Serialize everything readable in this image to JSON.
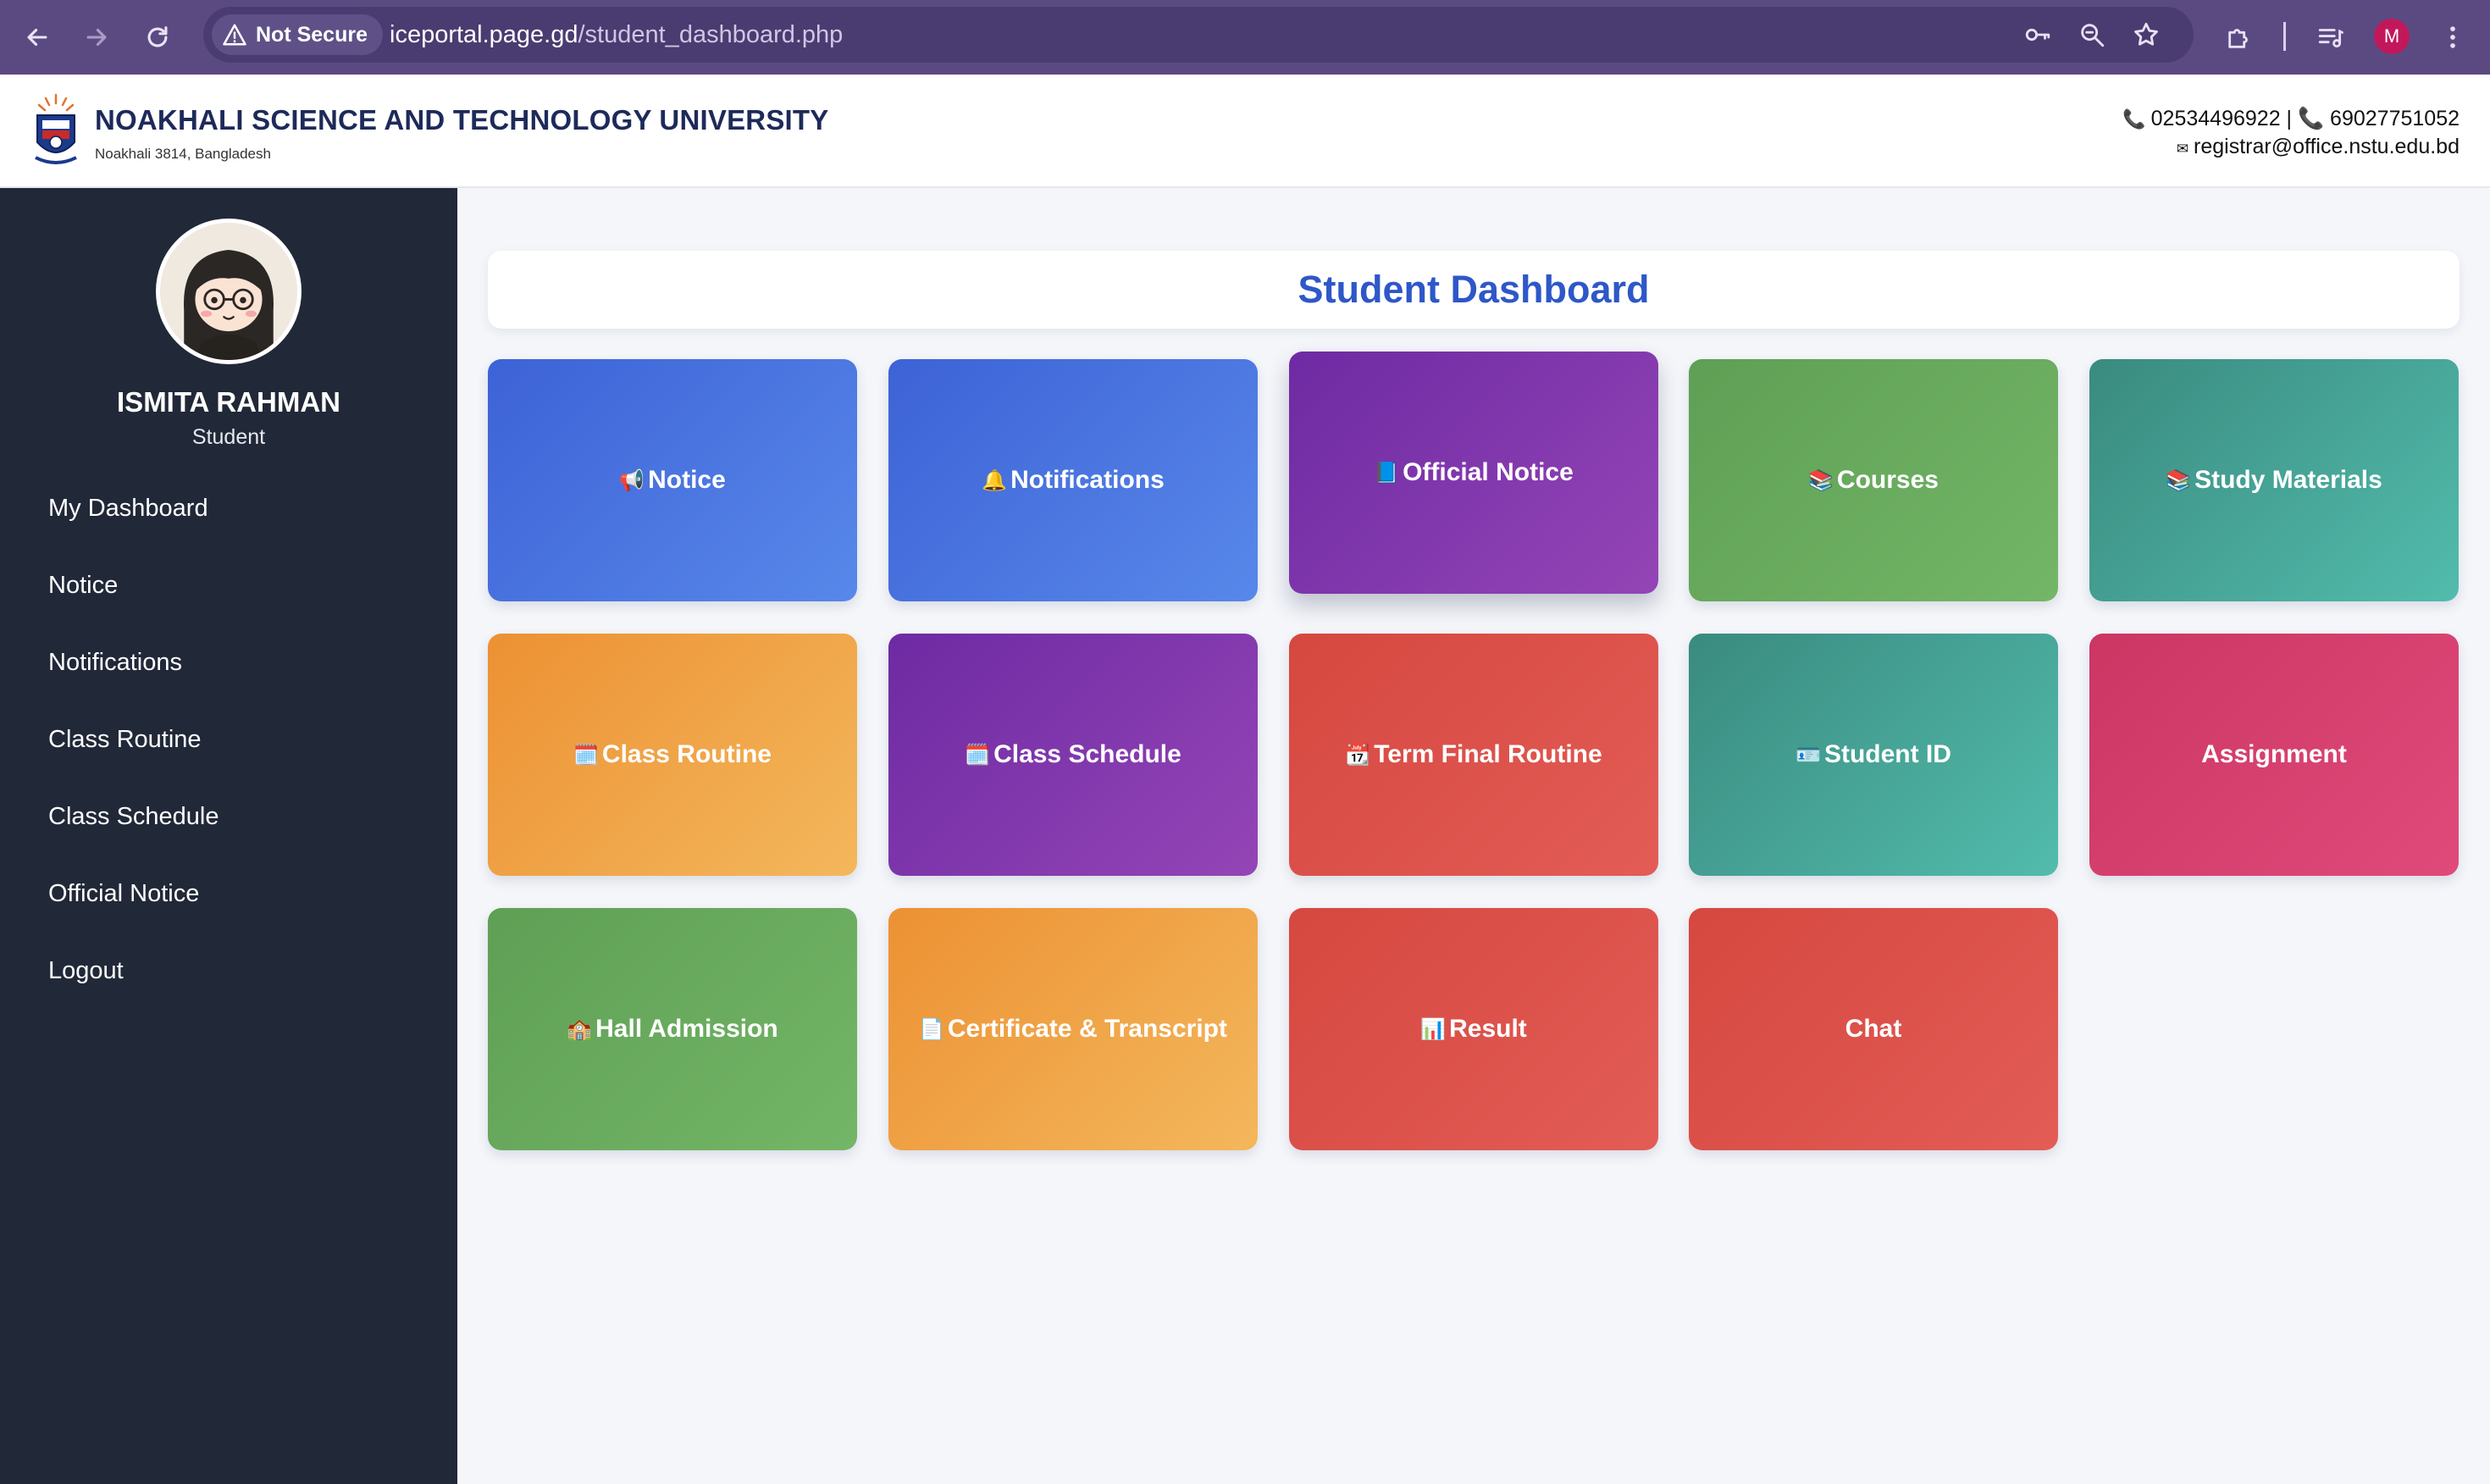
{
  "browser": {
    "security_label": "Not Secure",
    "url_host": "iceportal.page.gd",
    "url_path": "/student_dashboard.php",
    "profile_initial": "M"
  },
  "header": {
    "university_name": "NOAKHALI SCIENCE AND TECHNOLOGY UNIVERSITY",
    "address": "Noakhali 3814, Bangladesh",
    "phone_line": "02534496922 | 📞 69027751052",
    "email": "registrar@office.nstu.edu.bd"
  },
  "sidebar": {
    "user_name": "ISMITA RAHMAN",
    "user_role": "Student",
    "menu": [
      {
        "label": "My Dashboard"
      },
      {
        "label": "Notice"
      },
      {
        "label": "Notifications"
      },
      {
        "label": "Class Routine"
      },
      {
        "label": "Class Schedule"
      },
      {
        "label": "Official Notice"
      },
      {
        "label": "Logout"
      }
    ]
  },
  "main": {
    "title": "Student Dashboard",
    "tiles": [
      {
        "icon": "📢",
        "label": "Notice"
      },
      {
        "icon": "🔔",
        "label": " Notifications"
      },
      {
        "icon": "📘",
        "label": "Official Notice"
      },
      {
        "icon": "📚",
        "label": "Courses"
      },
      {
        "icon": "📚",
        "label": "Study Materials"
      },
      {
        "icon": "🗓️",
        "label": "Class Routine"
      },
      {
        "icon": "🗓️",
        "label": "Class Schedule"
      },
      {
        "icon": "📆",
        "label": " Term Final Routine"
      },
      {
        "icon": "🪪",
        "label": "Student ID"
      },
      {
        "icon": "",
        "label": "Assignment"
      },
      {
        "icon": "🏫",
        "label": " Hall Admission"
      },
      {
        "icon": "📄",
        "label": " Certificate & Transcript"
      },
      {
        "icon": "📊",
        "label": "Result"
      },
      {
        "icon": "",
        "label": "Chat"
      }
    ]
  },
  "colors": {
    "chrome": "#5b4a82",
    "sidebar": "#212838",
    "title_text": "#2e57c8"
  }
}
